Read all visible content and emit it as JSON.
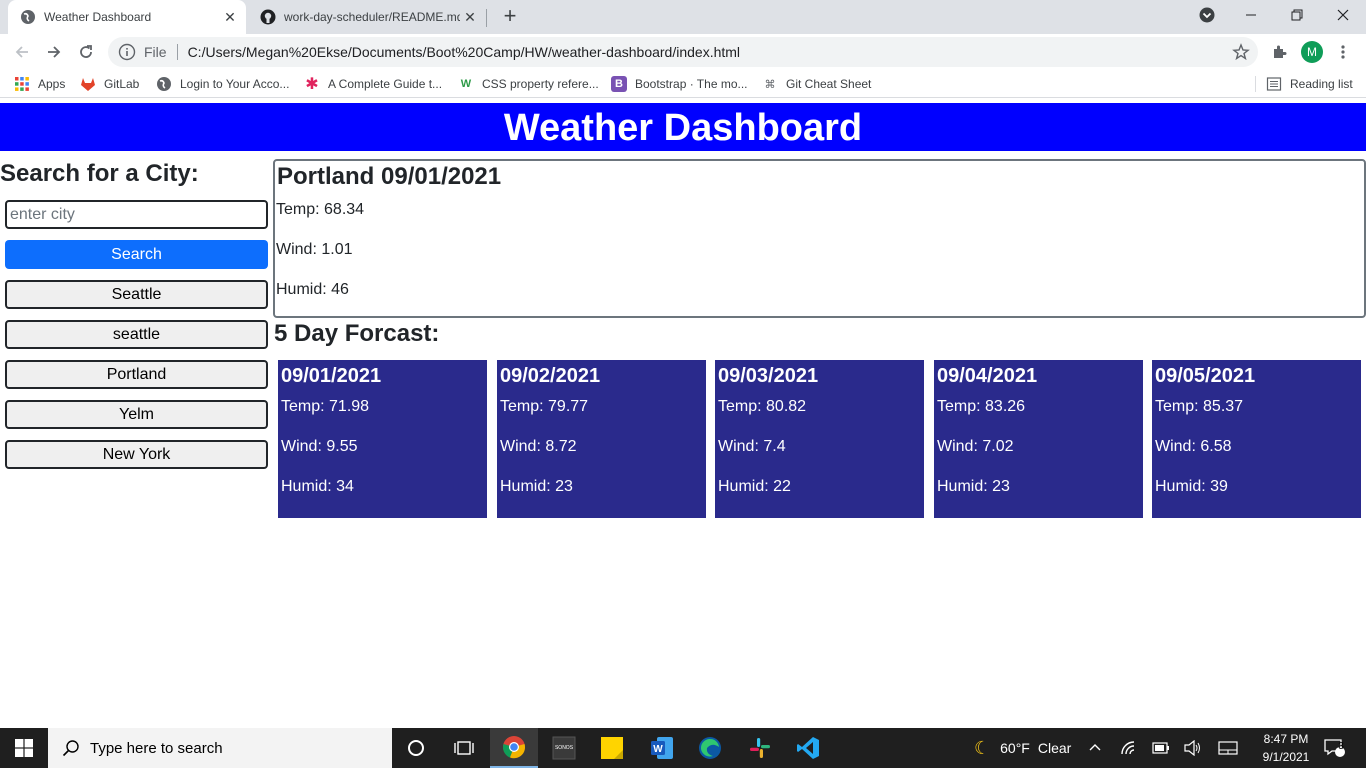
{
  "browser": {
    "tabs": [
      {
        "title": "Weather Dashboard",
        "active": true
      },
      {
        "title": "work-day-scheduler/README.md",
        "active": false
      }
    ],
    "address": {
      "scheme": "File",
      "url": "C:/Users/Megan%20Ekse/Documents/Boot%20Camp/HW/weather-dashboard/index.html"
    },
    "profile_initial": "M",
    "bookmarks": [
      {
        "label": "Apps",
        "icon": "apps-grid-icon"
      },
      {
        "label": "GitLab",
        "icon": "gitlab-icon"
      },
      {
        "label": "Login to Your Acco...",
        "icon": "globe-icon"
      },
      {
        "label": "A Complete Guide t...",
        "icon": "asterisk-icon"
      },
      {
        "label": "CSS property refere...",
        "icon": "w3-icon"
      },
      {
        "label": "Bootstrap · The mo...",
        "icon": "bootstrap-icon"
      },
      {
        "label": "Git Cheat Sheet",
        "icon": "command-icon"
      }
    ],
    "reading_list": "Reading list"
  },
  "page": {
    "banner_title": "Weather Dashboard",
    "search": {
      "heading": "Search for a City:",
      "placeholder": "enter city",
      "button_label": "Search"
    },
    "history": [
      "Seattle",
      "seattle",
      "Portland",
      "Yelm",
      "New York"
    ],
    "current": {
      "title": "Portland 09/01/2021",
      "temp": "Temp: 68.34",
      "wind": "Wind: 1.01",
      "humid": "Humid: 46"
    },
    "forecast_heading": "5 Day Forcast:",
    "forecast": [
      {
        "date": "09/01/2021",
        "temp": "Temp: 71.98",
        "wind": "Wind: 9.55",
        "humid": "Humid: 34"
      },
      {
        "date": "09/02/2021",
        "temp": "Temp: 79.77",
        "wind": "Wind: 8.72",
        "humid": "Humid: 23"
      },
      {
        "date": "09/03/2021",
        "temp": "Temp: 80.82",
        "wind": "Wind: 7.4",
        "humid": "Humid: 22"
      },
      {
        "date": "09/04/2021",
        "temp": "Temp: 83.26",
        "wind": "Wind: 7.02",
        "humid": "Humid: 23"
      },
      {
        "date": "09/05/2021",
        "temp": "Temp: 85.37",
        "wind": "Wind: 6.58",
        "humid": "Humid: 39"
      }
    ]
  },
  "taskbar": {
    "search_placeholder": "Type here to search",
    "weather_temp": "60°F",
    "weather_cond": "Clear",
    "time": "8:47 PM",
    "date": "9/1/2021",
    "notifications": "3"
  },
  "colors": {
    "banner": "#0000ff",
    "card": "#2a2a8c",
    "search_button": "#0d6efd"
  }
}
